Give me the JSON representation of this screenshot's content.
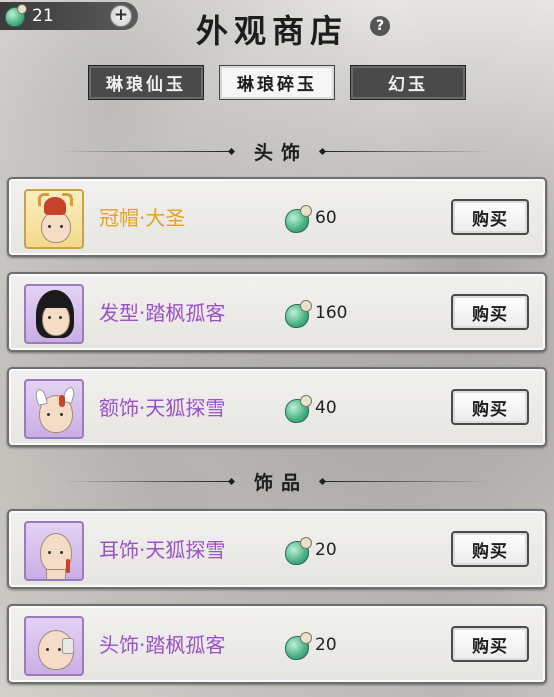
{
  "header": {
    "currency_value": "21",
    "plus_label": "+",
    "title": "外观商店",
    "help_label": "?"
  },
  "tabs": [
    {
      "label": "琳琅仙玉",
      "active": false
    },
    {
      "label": "琳琅碎玉",
      "active": true
    },
    {
      "label": "幻玉",
      "active": false
    }
  ],
  "sections": [
    {
      "title": "头饰",
      "items": [
        {
          "name": "冠帽·大圣",
          "price": "60",
          "rarity": "gold",
          "buy_label": "购买"
        },
        {
          "name": "发型·踏枫孤客",
          "price": "160",
          "rarity": "purple",
          "buy_label": "购买"
        },
        {
          "name": "额饰·天狐探雪",
          "price": "40",
          "rarity": "purple",
          "buy_label": "购买"
        }
      ]
    },
    {
      "title": "饰品",
      "items": [
        {
          "name": "耳饰·天狐探雪",
          "price": "20",
          "rarity": "purple",
          "buy_label": "购买"
        },
        {
          "name": "头饰·踏枫孤客",
          "price": "20",
          "rarity": "purple",
          "buy_label": "购买"
        }
      ]
    }
  ],
  "colors": {
    "gold_name": "#e6a21f",
    "purple_name": "#9a52c6",
    "tab_dark": "#4a4a4a",
    "tab_active": "#f6f6f4"
  },
  "icons": {
    "currency": "jade-fish-icon",
    "help": "question-icon",
    "plus": "plus-icon"
  }
}
